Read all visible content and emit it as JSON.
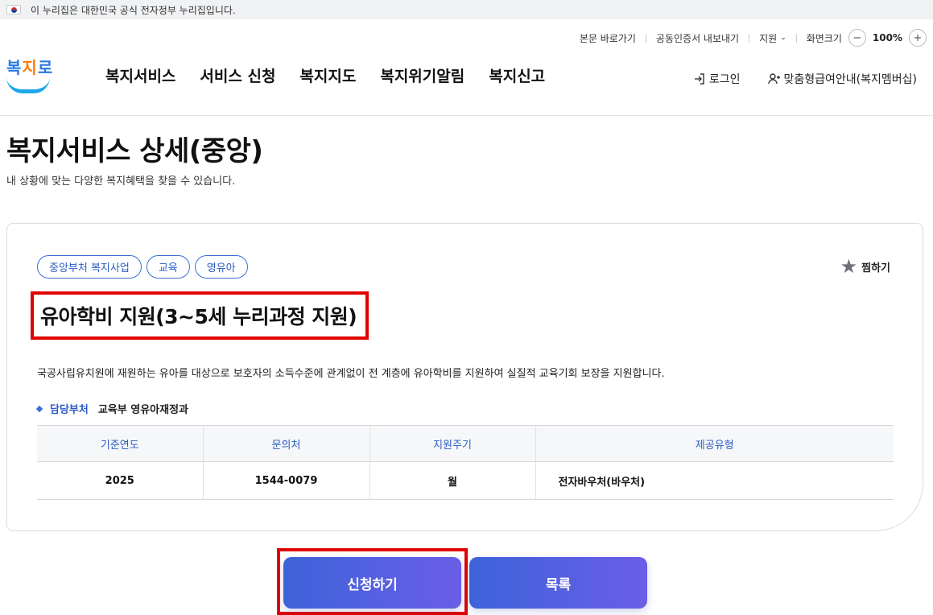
{
  "gov_banner": {
    "text": "이 누리집은 대한민국 공식 전자정부 누리집입니다."
  },
  "utility": {
    "skip_link": "본문 바로가기",
    "cert_export": "공동인증서 내보내기",
    "support": "지원",
    "screen_size": "화면크기",
    "zoom_out": "−",
    "zoom_level": "100%",
    "zoom_in": "+"
  },
  "logo": {
    "text_part1": "복",
    "text_part2": "지",
    "text_part3": "로"
  },
  "gnb": {
    "items": [
      "복지서비스",
      "서비스 신청",
      "복지지도",
      "복지위기알림",
      "복지신고"
    ]
  },
  "header_right": {
    "login": "로그인",
    "membership": "맞춤형급여안내(복지멤버십)"
  },
  "page": {
    "title": "복지서비스 상세(중앙)",
    "subtitle": "내 상황에 맞는 다양한 복지혜택을 찾을 수 있습니다."
  },
  "card": {
    "tags": [
      "중앙부처 복지사업",
      "교육",
      "영유아"
    ],
    "bookmark": "찜하기",
    "service_title": "유아학비 지원(3~5세 누리과정 지원)",
    "description": "국공사립유치원에 재원하는 유아를 대상으로 보호자의 소득수준에 관계없이 전 계층에 유아학비를 지원하여 실질적 교육기회 보장을 지원합니다.",
    "dept_label": "담당부처",
    "dept_value": "교육부 영유아재정과",
    "table": {
      "headers": [
        "기준연도",
        "문의처",
        "지원주기",
        "제공유형"
      ],
      "row": [
        "2025",
        "1544-0079",
        "월",
        "전자바우처(바우처)"
      ]
    }
  },
  "buttons": {
    "apply": "신청하기",
    "list": "목록"
  },
  "colors": {
    "accent": "#3b6fd6",
    "highlight": "#e00000",
    "button_start": "#3d63d9",
    "button_end": "#6b5ee6"
  }
}
